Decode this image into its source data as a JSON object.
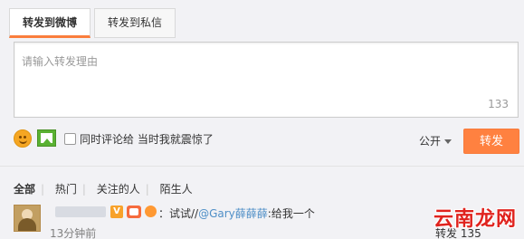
{
  "tabs": [
    {
      "label": "转发到微博"
    },
    {
      "label": "转发到私信"
    }
  ],
  "repost_input": {
    "placeholder": "请输入转发理由",
    "char_count": "133"
  },
  "toolbar": {
    "comment_checkbox_label": "同时评论给 当时我就震惊了",
    "visibility": "公开",
    "submit_label": "转发",
    "icons": {
      "emoji": "emoji-icon",
      "image": "image-icon"
    }
  },
  "filters": {
    "items": [
      "全部",
      "热门",
      "关注的人",
      "陌生人"
    ]
  },
  "comment": {
    "text_prefix": "：试试//",
    "mention": "@Gary薛薛薛",
    "text_suffix": ":给我一个",
    "time": "13分钟前",
    "repost_label": "转发 135"
  },
  "watermark": {
    "text": "云南龙网"
  },
  "colors": {
    "accent_orange": "#ff8140",
    "link_blue": "#4f8fc7"
  }
}
